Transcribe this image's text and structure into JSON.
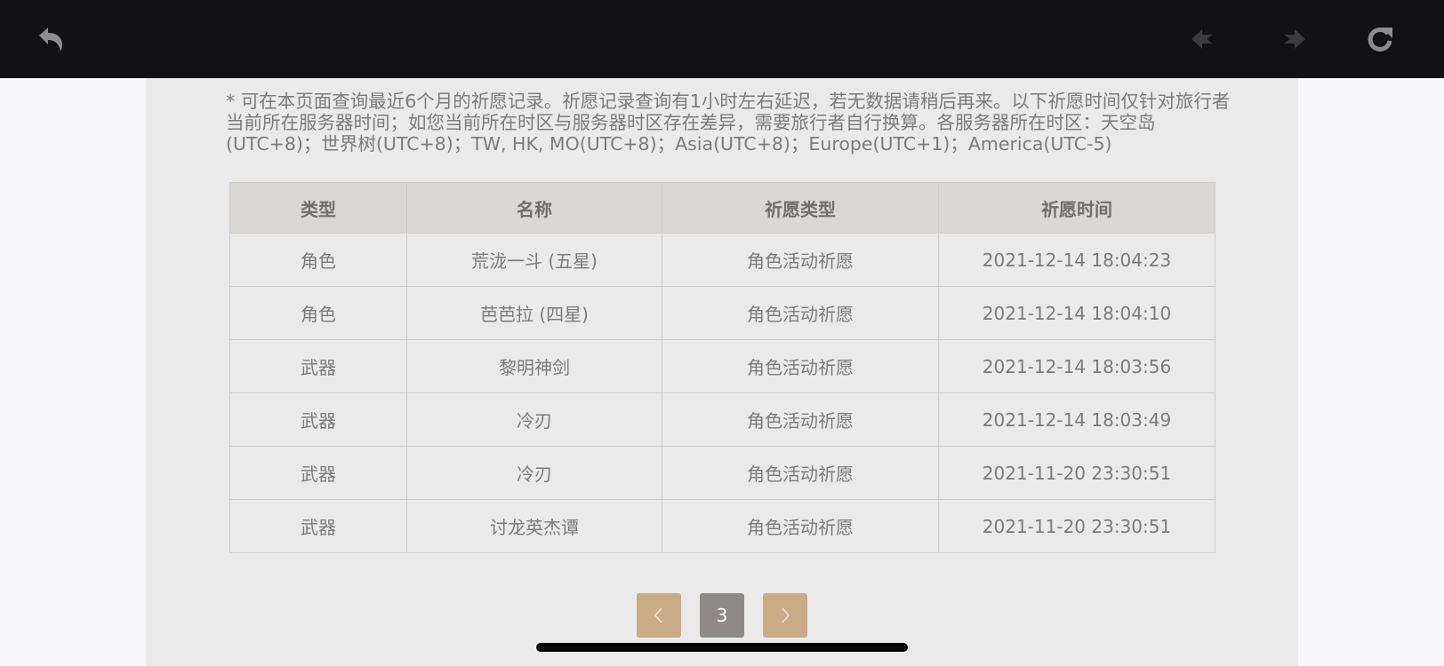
{
  "toolbar": {
    "back_icon": "back-arrow-icon",
    "prev_icon": "arrow-left-icon",
    "next_icon": "arrow-right-icon",
    "reload_icon": "reload-icon",
    "background": "#121214"
  },
  "notice": "* 可在本页面查询最近6个月的祈愿记录。祈愿记录查询有1小时左右延迟，若无数据请稍后再来。以下祈愿时间仅针对旅行者当前所在服务器时间；如您当前所在时区与服务器时区存在差异，需要旅行者自行换算。各服务器所在时区：天空岛(UTC+8)；世界树(UTC+8)；TW, HK, MO(UTC+8)；Asia(UTC+8)；Europe(UTC+1)；America(UTC-5)",
  "table": {
    "headers": [
      "类型",
      "名称",
      "祈愿类型",
      "祈愿时间"
    ],
    "rows": [
      {
        "type": "角色",
        "name": "荒泷一斗 (五星)",
        "wish_type": "角色活动祈愿",
        "time": "2021-12-14 18:04:23"
      },
      {
        "type": "角色",
        "name": "芭芭拉 (四星)",
        "wish_type": "角色活动祈愿",
        "time": "2021-12-14 18:04:10"
      },
      {
        "type": "武器",
        "name": "黎明神剑",
        "wish_type": "角色活动祈愿",
        "time": "2021-12-14 18:03:56"
      },
      {
        "type": "武器",
        "name": "冷刃",
        "wish_type": "角色活动祈愿",
        "time": "2021-12-14 18:03:49"
      },
      {
        "type": "武器",
        "name": "冷刃",
        "wish_type": "角色活动祈愿",
        "time": "2021-11-20 23:30:51"
      },
      {
        "type": "武器",
        "name": "讨龙英杰谭",
        "wish_type": "角色活动祈愿",
        "time": "2021-11-20 23:30:51"
      }
    ]
  },
  "colors": {
    "five_star": "#b4763a",
    "four_star": "#9150c8",
    "pager_nav": "#c9ab86",
    "pager_current": "#8f8987"
  },
  "pagination": {
    "current_page": "3",
    "prev_icon": "chevron-left-icon",
    "next_icon": "chevron-right-icon"
  }
}
